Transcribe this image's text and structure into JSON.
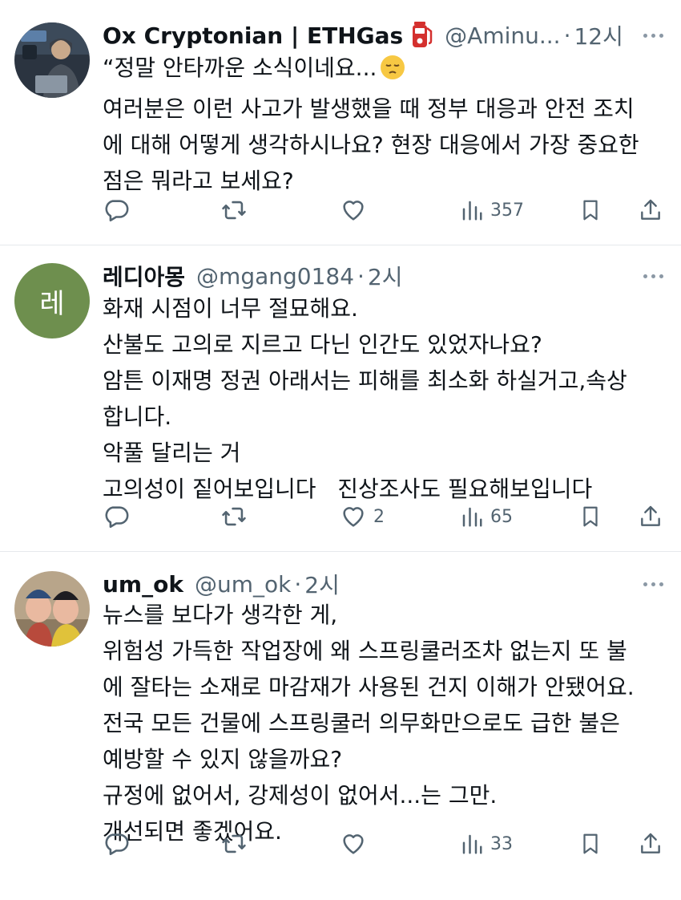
{
  "tweets": [
    {
      "name": "Ox Cryptonian | ETHGas",
      "handle": "@Aminu...",
      "sep": "·",
      "time": "12시",
      "lines": [
        "“정말 안타까운 소식이네요...",
        "여러분은 이런 사고가 발생했을 때 정부 대응과 안전 조치",
        "에 대해 어떻게 생각하시나요? 현장 대응에서 가장 중요한",
        "점은 뭐라고 보세요?"
      ],
      "emoji": "pensive-face",
      "badge_icon": "fuel-pump-icon",
      "likes": "",
      "views": "357"
    },
    {
      "name": "레디아몽",
      "avatar_letter": "레",
      "handle": "@mgang0184",
      "sep": "·",
      "time": "2시",
      "lines": [
        "화재 시점이 너무 절묘해요.",
        "산불도 고의로 지르고 다닌 인간도 있었자나요?",
        "암튼 이재명 정권 아래서는 피해를 최소화 하실거고,속상",
        "합니다.",
        "악풀 달리는 거",
        "고의성이 짙어보입니다   진상조사도 필요해보입니다"
      ],
      "likes": "2",
      "views": "65"
    },
    {
      "name": "um_ok",
      "handle": "@um_ok",
      "sep": "·",
      "time": "2시",
      "lines": [
        "뉴스를 보다가 생각한 게,",
        "위험성 가득한 작업장에 왜 스프링쿨러조차 없는지 또 불",
        "에 잘타는 소재로 마감재가 사용된 건지 이해가 안됐어요.",
        "전국 모든 건물에 스프링쿨러 의무화만으로도 급한 불은",
        "예방할 수 있지 않을까요?",
        "규정에 없어서, 강제성이 없어서...는 그만.",
        "개선되면 좋겠어요."
      ],
      "likes": "",
      "views": "33"
    }
  ],
  "colors": {
    "text": "#0f1419",
    "muted": "#536471",
    "avatar_green": "#6e8f4e",
    "badge_red": "#d4302e"
  }
}
